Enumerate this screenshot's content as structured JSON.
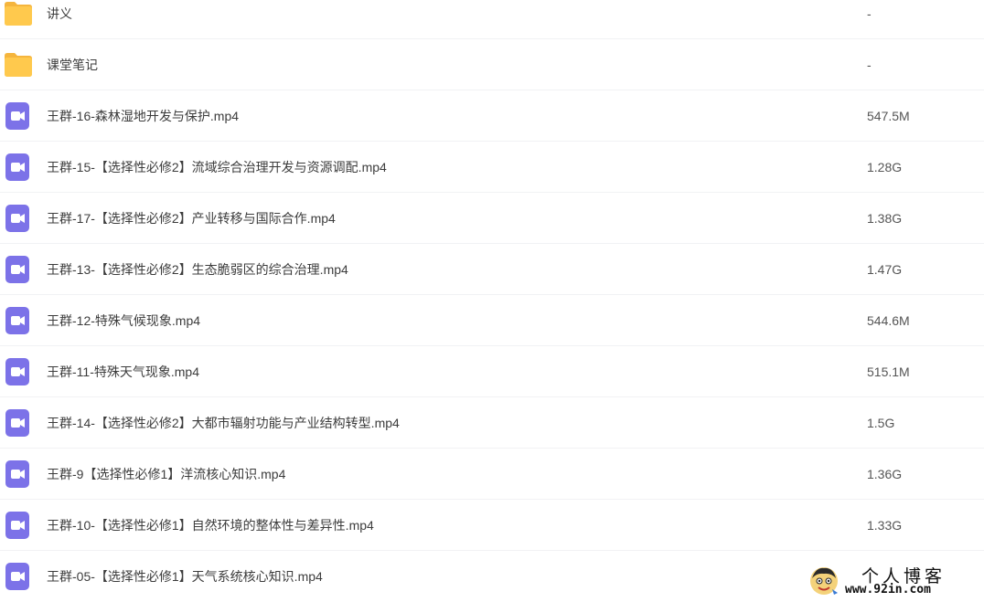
{
  "colors": {
    "folder": "#ffc94d",
    "folder_back": "#f5b53d",
    "video": "#7c72e8",
    "row_divider": "#f1f2f4"
  },
  "files": [
    {
      "type": "folder",
      "icon": "folder-icon",
      "name": "讲义",
      "size": "-"
    },
    {
      "type": "folder",
      "icon": "folder-icon",
      "name": "课堂笔记",
      "size": "-"
    },
    {
      "type": "video",
      "icon": "video-file-icon",
      "name": "王群-16-森林湿地开发与保护.mp4",
      "size": "547.5M"
    },
    {
      "type": "video",
      "icon": "video-file-icon",
      "name": "王群-15-【选择性必修2】流域综合治理开发与资源调配.mp4",
      "size": "1.28G"
    },
    {
      "type": "video",
      "icon": "video-file-icon",
      "name": "王群-17-【选择性必修2】产业转移与国际合作.mp4",
      "size": "1.38G"
    },
    {
      "type": "video",
      "icon": "video-file-icon",
      "name": "王群-13-【选择性必修2】生态脆弱区的综合治理.mp4",
      "size": "1.47G"
    },
    {
      "type": "video",
      "icon": "video-file-icon",
      "name": "王群-12-特殊气候现象.mp4",
      "size": "544.6M"
    },
    {
      "type": "video",
      "icon": "video-file-icon",
      "name": "王群-11-特殊天气现象.mp4",
      "size": "515.1M"
    },
    {
      "type": "video",
      "icon": "video-file-icon",
      "name": "王群-14-【选择性必修2】大都市辐射功能与产业结构转型.mp4",
      "size": "1.5G"
    },
    {
      "type": "video",
      "icon": "video-file-icon",
      "name": "王群-9【选择性必修1】洋流核心知识.mp4",
      "size": "1.36G"
    },
    {
      "type": "video",
      "icon": "video-file-icon",
      "name": "王群-10-【选择性必修1】自然环境的整体性与差异性.mp4",
      "size": "1.33G"
    },
    {
      "type": "video",
      "icon": "video-file-icon",
      "name": "王群-05-【选择性必修1】天气系统核心知识.mp4",
      "size": ""
    }
  ],
  "watermark": {
    "title": "个人博客",
    "url": "www.92in.com",
    "logo_icon": "cartoon-avatar-logo"
  }
}
